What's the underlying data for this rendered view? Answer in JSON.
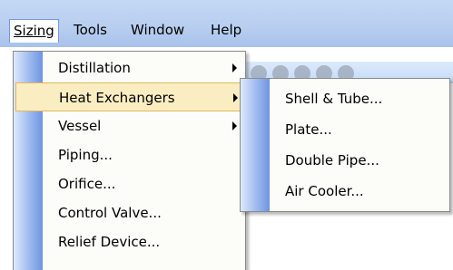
{
  "menubar": {
    "items": [
      {
        "label": "Sizing",
        "active": true
      },
      {
        "label": "Tools",
        "active": false
      },
      {
        "label": "Window",
        "active": false
      },
      {
        "label": "Help",
        "active": false
      }
    ]
  },
  "sizing_menu": {
    "items": [
      {
        "label": "Distillation",
        "has_submenu": true
      },
      {
        "label": "Heat Exchangers",
        "has_submenu": true,
        "highlighted": true
      },
      {
        "label": "Vessel",
        "has_submenu": true
      },
      {
        "label": "Piping...",
        "has_submenu": false
      },
      {
        "label": "Orifice...",
        "has_submenu": false
      },
      {
        "label": "Control Valve...",
        "has_submenu": false
      },
      {
        "label": "Relief Device...",
        "has_submenu": false
      }
    ]
  },
  "heat_exchangers_submenu": {
    "items": [
      {
        "label": "Shell & Tube..."
      },
      {
        "label": "Plate..."
      },
      {
        "label": "Double Pipe..."
      },
      {
        "label": "Air Cooler..."
      }
    ]
  },
  "colors": {
    "menubar": "#b9cff0",
    "highlight_fill": "#fbedc2",
    "highlight_border": "#e2b85b",
    "menu_bg": "#fcfcf9",
    "icon_strip": "#9dbaf0"
  }
}
